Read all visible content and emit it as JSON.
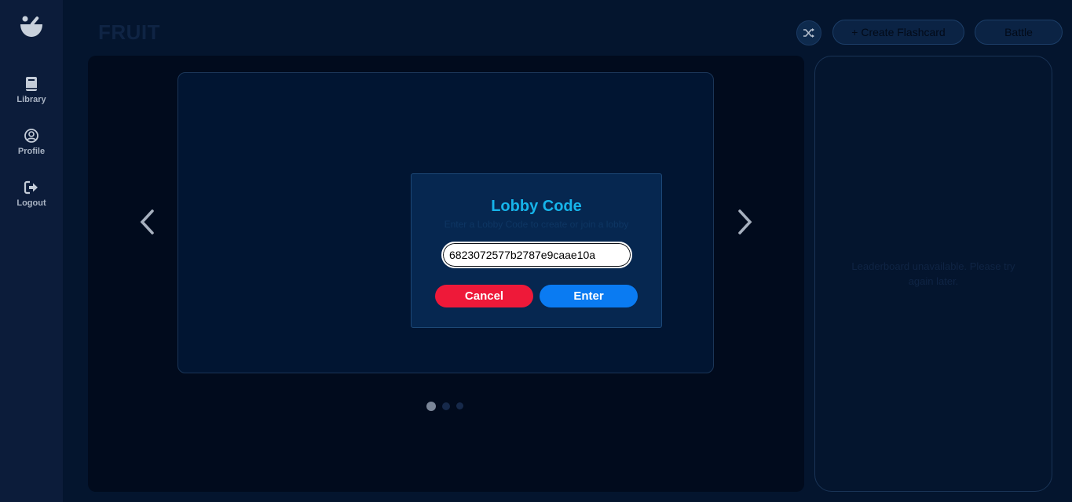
{
  "sidebar": {
    "logo_icon": "mortar-pestle-icon",
    "items": [
      {
        "label": "Library",
        "icon": "book-icon"
      },
      {
        "label": "Profile",
        "icon": "user-circle-icon"
      },
      {
        "label": "Logout",
        "icon": "logout-icon"
      }
    ]
  },
  "header": {
    "title": "FRUIT",
    "shuffle_icon": "shuffle-icon",
    "create_label": "+ Create Flashcard",
    "battle_label": "Battle"
  },
  "carousel": {
    "prev_icon": "chevron-left-icon",
    "next_icon": "chevron-right-icon",
    "active_index": 0,
    "dot_count": 3
  },
  "leaderboard": {
    "message": "Leaderboard unavailable. Please try again later."
  },
  "modal": {
    "title": "Lobby Code",
    "subtitle": "Enter a Lobby Code to create or join a lobby",
    "input_value": "6823072577b2787e9caae10a",
    "cancel_label": "Cancel",
    "enter_label": "Enter"
  },
  "colors": {
    "background": "#04152e",
    "sidebar": "#0c1c3a",
    "accent_title": "#16b4ea",
    "cancel": "#ee1939",
    "enter": "#0a7bf2"
  }
}
